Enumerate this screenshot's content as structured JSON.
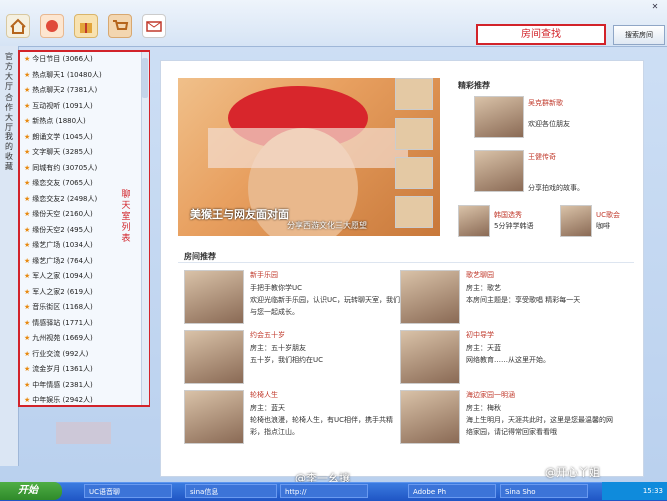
{
  "toolbar": {
    "room_search_label": "房间查找",
    "search_button_label": "搜索房间",
    "icons": [
      "home-icon",
      "chat-icon",
      "gift-icon",
      "cart-icon",
      "mail-icon"
    ]
  },
  "side_tabs": [
    "官方大厅",
    "合作大厅",
    "我的收藏"
  ],
  "room_list": {
    "annotation": "聊天室列表",
    "items": [
      "今日节目 (3066人)",
      "热点聊天1 (10480人)",
      "热点聊天2 (7381人)",
      "互动视听 (1091人)",
      "新热点 (1880人)",
      "朗诵文学 (1045人)",
      "文字聊天 (3285人)",
      "同城有约 (30705人)",
      "缘恋交友 (7065人)",
      "缘恋交友2 (2498人)",
      "缘份天空 (2160人)",
      "缘份天空2 (495人)",
      "缘艺广场 (1034人)",
      "缘艺广场2 (764人)",
      "军人之家 (1094人)",
      "军人之家2 (619人)",
      "音乐街区 (1168人)",
      "情感驿站 (1771人)",
      "九州视苑 (1669人)",
      "行业交流 (992人)",
      "流金岁月 (1361人)",
      "中年情感 (2381人)",
      "中年娱乐 (2942人)"
    ]
  },
  "hero": {
    "title": "美猴王与网友面对面",
    "subtitle": "分享西游文化三大愿望"
  },
  "featured": {
    "title": "精彩推荐",
    "entries": [
      {
        "name": "吴克群新歌",
        "desc": "欢迎各位朋友"
      },
      {
        "name": "王健传奇",
        "desc": "分享拍戏的故事。"
      }
    ],
    "mini": [
      {
        "name": "韩国选秀",
        "desc": "5分钟学韩语"
      },
      {
        "name": "UC歌会",
        "desc": "咖啡"
      }
    ]
  },
  "rooms": {
    "title": "房间推荐",
    "cards": [
      {
        "name": "新手乐园",
        "owner": "手把手教你学UC",
        "desc": "欢迎光临新手乐园，认识UC，玩转聊天室，我们与您一起成长。"
      },
      {
        "name": "歌艺聊园",
        "owner": "房主：歌艺",
        "desc": "本房间主题是：享受歌唱 精彩每一天"
      },
      {
        "name": "约会五十岁",
        "owner": "房主：五十岁朋友",
        "desc": "五十岁，我们相约在UC"
      },
      {
        "name": "初中导学",
        "owner": "房主：天蓝",
        "desc": "网络教育……从这里开始。"
      },
      {
        "name": "轮椅人生",
        "owner": "房主：蓝天",
        "desc": "轮椅也浪漫，轮椅人生，有UC相伴，携手共精彩，指点江山。"
      },
      {
        "name": "海边家园一明涵",
        "owner": "房主：梅秋",
        "desc": "海上生明月，天涯共此时，这里是您最温馨的网络家园，请记得常回家看看哦"
      }
    ]
  },
  "taskbar": {
    "start_label": "开始",
    "tasks": [
      "UC语音聊",
      "sina信息",
      "http://",
      "Adobe Ph",
      "Sina Sho"
    ],
    "clock": "15:33"
  },
  "watermarks": [
    "@李一幺攘",
    "@开心丫姐"
  ],
  "colors": {
    "accent": "#d2232a",
    "taskbar": "#245edc",
    "start": "#3c9a36"
  }
}
